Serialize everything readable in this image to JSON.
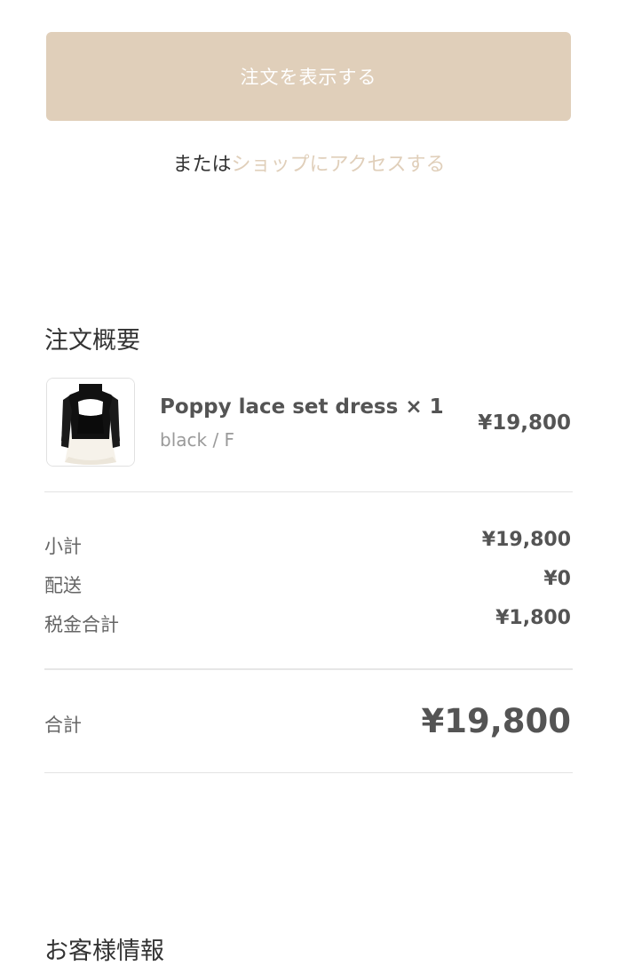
{
  "actions": {
    "view_order_label": "注文を表示する",
    "or_text": "または",
    "shop_link_label": "ショップにアクセスする"
  },
  "order_summary": {
    "title": "注文概要",
    "items": [
      {
        "name": "Poppy lace set dress × 1",
        "variant": "black / F",
        "price": "¥19,800",
        "image_icon": "dress-thumbnail"
      }
    ],
    "subtotal_label": "小計",
    "subtotal_value": "¥19,800",
    "shipping_label": "配送",
    "shipping_value": "¥0",
    "tax_label": "税金合計",
    "tax_value": "¥1,800",
    "total_label": "合計",
    "total_value": "¥19,800"
  },
  "customer_info": {
    "title": "お客様情報"
  },
  "colors": {
    "accent": "#e0cfba",
    "text": "#333333",
    "muted": "#9a9a9a"
  }
}
